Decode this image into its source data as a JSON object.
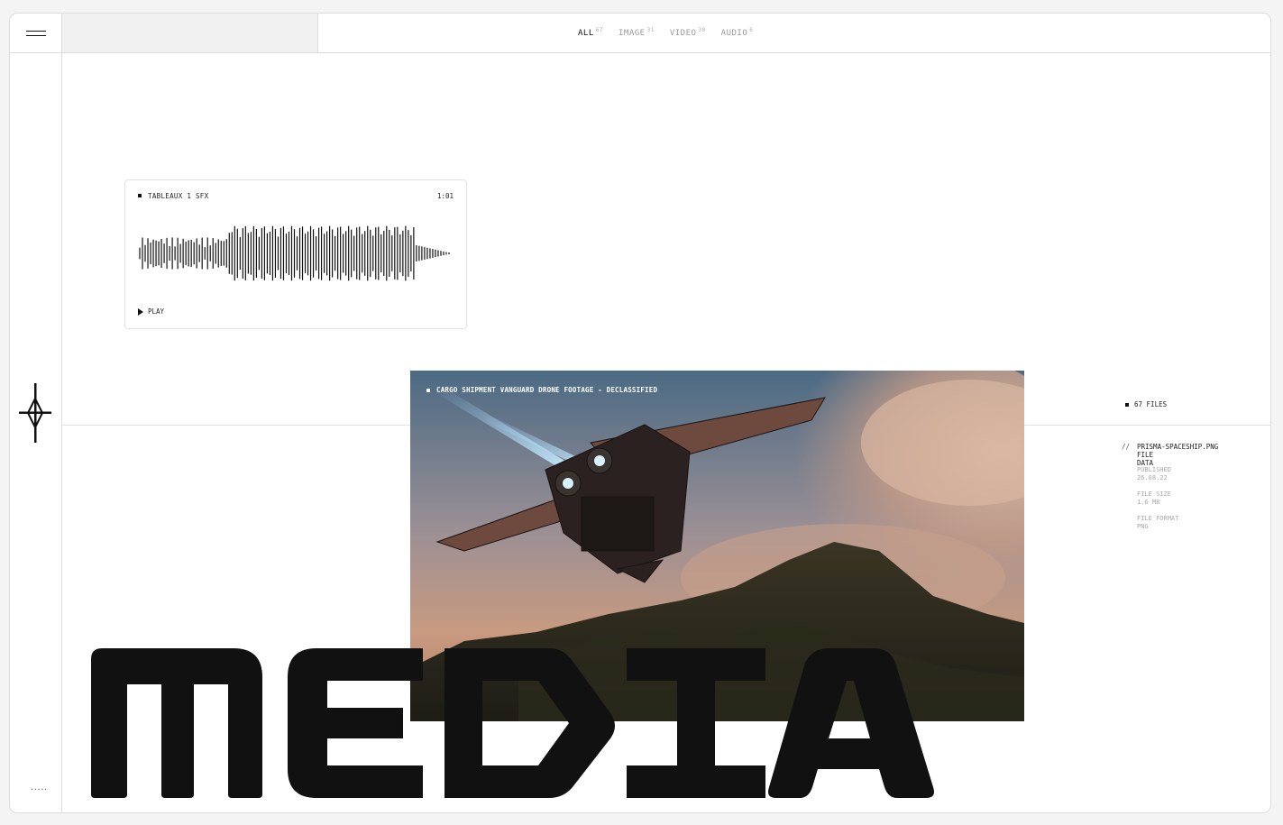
{
  "nav": {
    "tabs": [
      {
        "label": "ALL",
        "count": "67"
      },
      {
        "label": "IMAGE",
        "count": "31"
      },
      {
        "label": "VIDEO",
        "count": "30"
      },
      {
        "label": "AUDIO",
        "count": "6"
      }
    ]
  },
  "audio_card": {
    "title": "TABLEAUX 1 SFX",
    "duration": "1:01",
    "play_label": "PLAY"
  },
  "media": {
    "caption": "CARGO SHIPMENT VANGUARD DRONE FOOTAGE - DECLASSIFIED"
  },
  "files": {
    "count_label": "67 FILES"
  },
  "file_info": {
    "slash": "//",
    "name": "PRISMA-SPACESHIP.PNG",
    "subtitle": "FILE DATA",
    "published_label": "PUBLISHED",
    "published_value": "26.08.22",
    "size_label": "FILE SIZE",
    "size_value": "1.6 MB",
    "format_label": "FILE FORMAT",
    "format_value": "PNG"
  },
  "footer": {
    "dots": "....."
  },
  "headline": "MEDIA",
  "colors": {
    "ink": "#111111",
    "border": "#dcdcdc",
    "muted": "#999999"
  }
}
